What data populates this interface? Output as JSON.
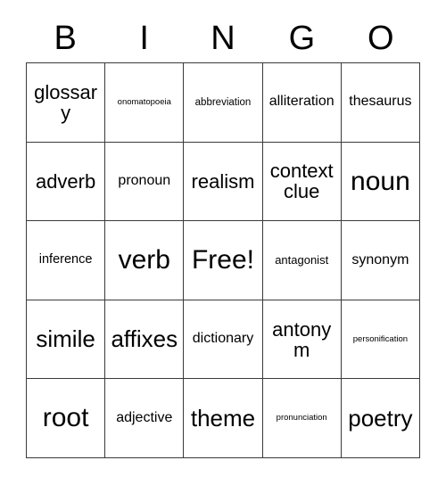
{
  "card": {
    "title": "BINGO",
    "header_letters": [
      "B",
      "I",
      "N",
      "G",
      "O"
    ],
    "free_space_label": "Free!",
    "colors": {
      "background": "#ffffff",
      "cell_background": "#ffffff",
      "border": "#3a3a3a",
      "text": "#000000"
    },
    "grid": {
      "columns": 5,
      "rows": 5,
      "cells": [
        {
          "text": "glossary",
          "size": "xl"
        },
        {
          "text": "onomatopoeia",
          "size": "xs"
        },
        {
          "text": "abbreviation",
          "size": "s"
        },
        {
          "text": "alliteration",
          "size": "ml"
        },
        {
          "text": "thesaurus",
          "size": "ml"
        },
        {
          "text": "adverb",
          "size": "xl"
        },
        {
          "text": "pronoun",
          "size": "ml"
        },
        {
          "text": "realism",
          "size": "xl"
        },
        {
          "text": "context clue",
          "size": "xl"
        },
        {
          "text": "noun",
          "size": "xxxl"
        },
        {
          "text": "inference",
          "size": "m"
        },
        {
          "text": "verb",
          "size": "xxxl"
        },
        {
          "text": "Free!",
          "size": "xxxl"
        },
        {
          "text": "antagonist",
          "size": "sm"
        },
        {
          "text": "synonym",
          "size": "ml"
        },
        {
          "text": "simile",
          "size": "xxl"
        },
        {
          "text": "affixes",
          "size": "xxl"
        },
        {
          "text": "dictionary",
          "size": "ml"
        },
        {
          "text": "antonym",
          "size": "xl"
        },
        {
          "text": "personification",
          "size": "xs"
        },
        {
          "text": "root",
          "size": "xxxl"
        },
        {
          "text": "adjective",
          "size": "ml"
        },
        {
          "text": "theme",
          "size": "xxl"
        },
        {
          "text": "pronunciation",
          "size": "xs"
        },
        {
          "text": "poetry",
          "size": "xxl"
        }
      ]
    }
  }
}
